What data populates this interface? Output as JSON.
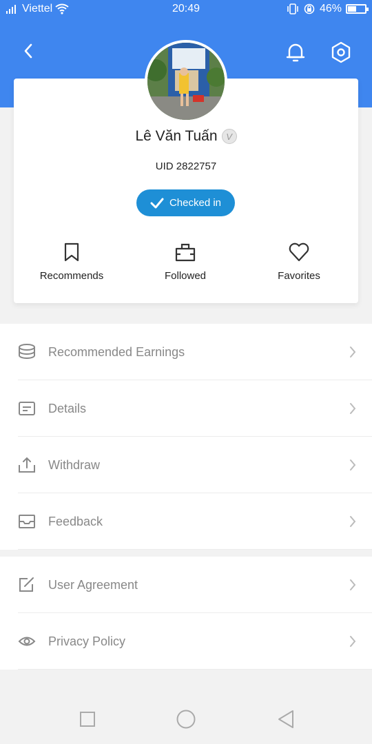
{
  "status_bar": {
    "carrier": "Viettel",
    "time": "20:49",
    "battery_percent": "46%",
    "battery_level": 0.46
  },
  "header": {
    "back_icon": "chevron-left-icon",
    "notification_icon": "bell-icon",
    "settings_icon": "hexagon-gear-icon"
  },
  "profile": {
    "name": "Lê Văn Tuấn",
    "verified_badge": "V",
    "uid": "UID 2822757",
    "checkin_label": "Checked in"
  },
  "stats": [
    {
      "label": "Recommends",
      "icon": "bookmark-icon"
    },
    {
      "label": "Followed",
      "icon": "bag-icon"
    },
    {
      "label": "Favorites",
      "icon": "heart-icon"
    }
  ],
  "menu_group_1": [
    {
      "label": "Recommended Earnings",
      "icon": "coins-icon"
    },
    {
      "label": "Details",
      "icon": "list-card-icon"
    },
    {
      "label": "Withdraw",
      "icon": "upload-tray-icon"
    },
    {
      "label": "Feedback",
      "icon": "inbox-icon"
    }
  ],
  "menu_group_2": [
    {
      "label": "User Agreement",
      "icon": "edit-icon"
    },
    {
      "label": "Privacy Policy",
      "icon": "eye-icon"
    }
  ],
  "colors": {
    "header_blue": "#3f86ef",
    "checkin_blue": "#1e8fd6",
    "page_bg": "#f2f2f2"
  }
}
